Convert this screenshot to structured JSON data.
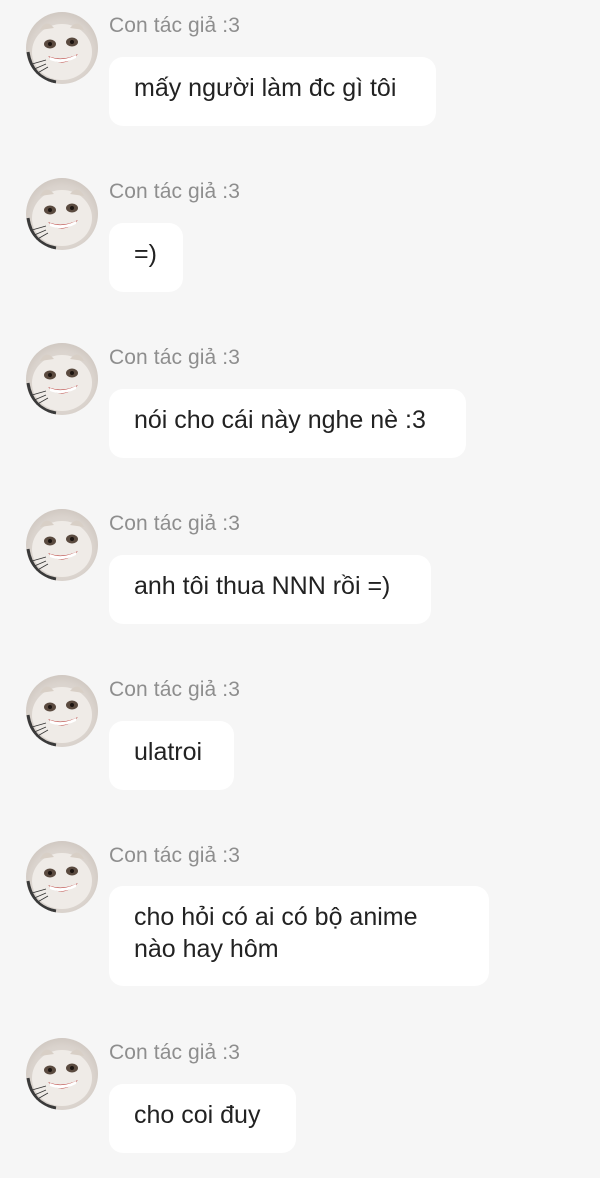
{
  "messages": [
    {
      "sender": "Con tác giả :3",
      "lines": [
        "mấy người làm đc gì tôi"
      ]
    },
    {
      "sender": "Con tác giả :3",
      "lines": [
        "=)"
      ]
    },
    {
      "sender": "Con tác giả :3",
      "lines": [
        "nói cho cái này nghe nè :3"
      ]
    },
    {
      "sender": "Con tác giả :3",
      "lines": [
        "anh tôi thua NNN rồi =)"
      ]
    },
    {
      "sender": "Con tác giả :3",
      "lines": [
        "ulatroi"
      ]
    },
    {
      "sender": "Con tác giả :3",
      "lines": [
        "cho hỏi có ai có bộ anime",
        "nào hay hôm"
      ]
    },
    {
      "sender": "Con tác giả :3",
      "lines": [
        "cho coi đuy"
      ]
    }
  ],
  "icons": {
    "avatar": "cat-avatar-icon"
  }
}
